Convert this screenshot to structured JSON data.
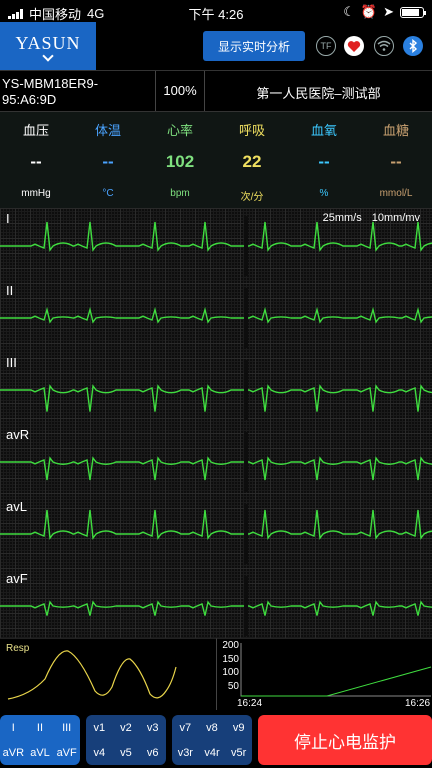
{
  "statusbar": {
    "carrier": "中国移动",
    "network": "4G",
    "time": "下午 4:26",
    "battery_level": 0.85
  },
  "header": {
    "brand": "YASUN",
    "realtime_label": "显示实时分析",
    "tf_label": "TF"
  },
  "device": {
    "id": "YS-MBM18ER9-95:A6:9D",
    "battery": "100%",
    "hospital": "第一人民医院–测试部"
  },
  "vitals": [
    {
      "label": "血压",
      "value": "--",
      "unit": "mmHg",
      "color": "#ffffff"
    },
    {
      "label": "体温",
      "value": "--",
      "unit": "°C",
      "color": "#4aa3ff"
    },
    {
      "label": "心率",
      "value": "102",
      "unit": "bpm",
      "color": "#7fe07f"
    },
    {
      "label": "呼吸",
      "value": "22",
      "unit": "次/分",
      "color": "#f0e060"
    },
    {
      "label": "血氧",
      "value": "--",
      "unit": "%",
      "color": "#3cc8ff"
    },
    {
      "label": "血糖",
      "value": "--",
      "unit": "mmol/L",
      "color": "#c8a070"
    }
  ],
  "ecg": {
    "speed": "25mm/s",
    "gain": "10mm/mv",
    "leads": [
      {
        "name": "I",
        "polarity": 1
      },
      {
        "name": "II",
        "polarity": 0.35
      },
      {
        "name": "III",
        "polarity": -0.9
      },
      {
        "name": "avR",
        "polarity": -0.75
      },
      {
        "name": "avL",
        "polarity": 1
      },
      {
        "name": "avF",
        "polarity": -0.4
      }
    ],
    "color": "#3fdc3f"
  },
  "resp": {
    "label": "Resp",
    "color": "#e8d44a"
  },
  "trend": {
    "y_ticks": [
      "200",
      "150",
      "100",
      "50"
    ],
    "x_start": "16:24",
    "x_end": "16:26",
    "color": "#3fdc3f"
  },
  "buttons": {
    "limb": [
      "I",
      "II",
      "III",
      "aVR",
      "aVL",
      "aVF"
    ],
    "chest1": [
      "v1",
      "v2",
      "v3",
      "v4",
      "v5",
      "v6"
    ],
    "chest2": [
      "v7",
      "v8",
      "v9",
      "v3r",
      "v4r",
      "v5r"
    ],
    "stop": "停止心电监护"
  }
}
